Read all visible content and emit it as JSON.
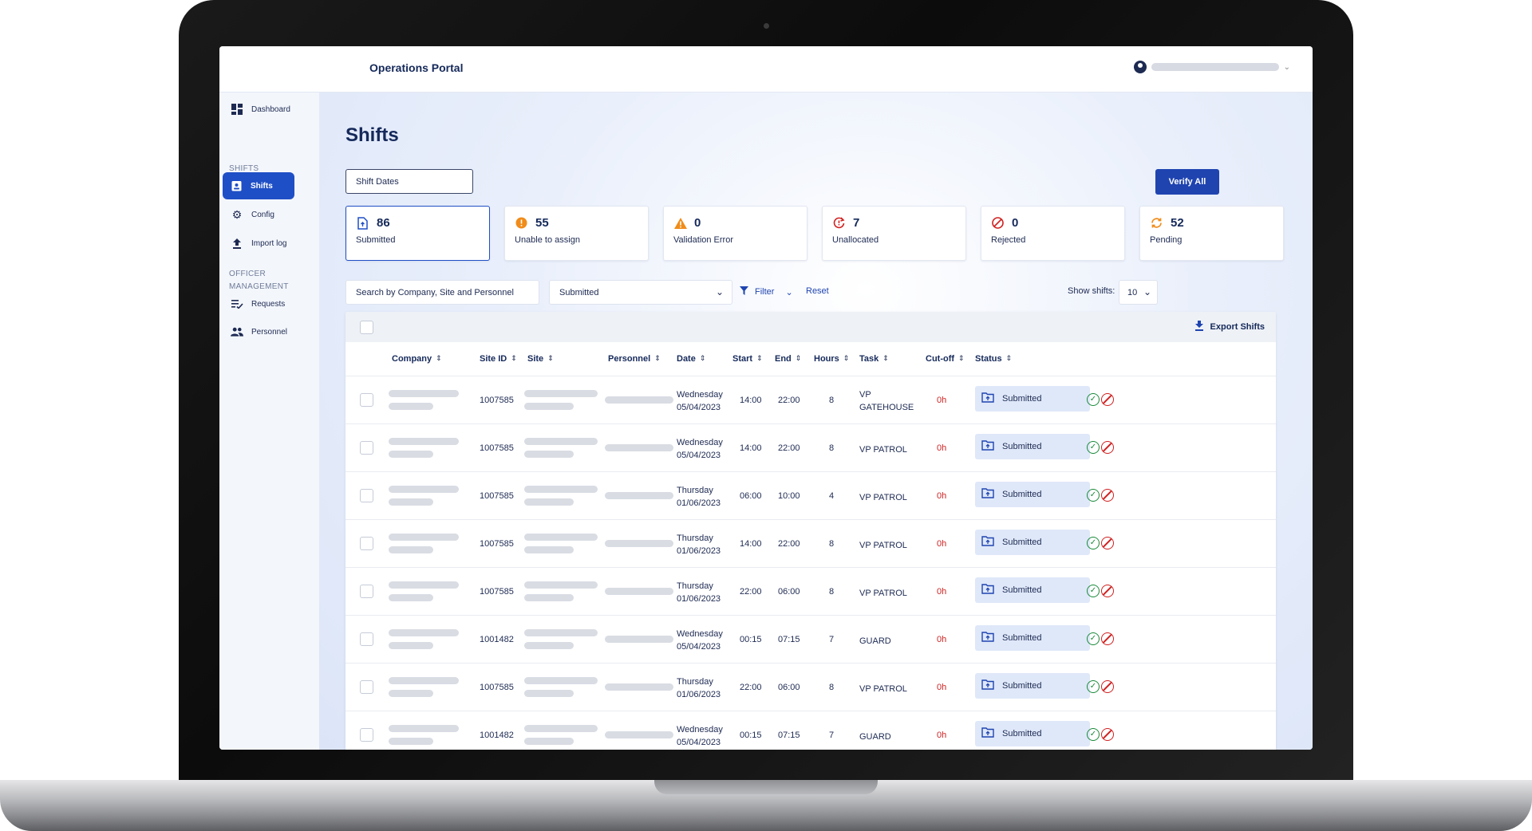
{
  "app": {
    "title": "Operations Portal"
  },
  "sidebar": {
    "items": [
      {
        "label": "Dashboard",
        "icon": "dashboard-icon"
      },
      {
        "label": "Shifts",
        "icon": "badge-icon",
        "active": true
      },
      {
        "label": "Config",
        "icon": "gear-icon"
      },
      {
        "label": "Import log",
        "icon": "upload-icon"
      },
      {
        "label": "Requests",
        "icon": "checklist-icon"
      },
      {
        "label": "Personnel",
        "icon": "people-icon"
      }
    ],
    "sections": {
      "shifts": "SHIFTS",
      "officer_line1": "OFFICER",
      "officer_line2": "MANAGEMENT"
    }
  },
  "page": {
    "title": "Shifts",
    "shift_dates": "Shift Dates",
    "verify_all": "Verify All"
  },
  "cards": [
    {
      "count": "86",
      "label": "Submitted",
      "icon": "file-upload-icon",
      "color": "#1f4fc6"
    },
    {
      "count": "55",
      "label": "Unable to assign",
      "icon": "alert-circle-icon",
      "color": "#f08c1a"
    },
    {
      "count": "0",
      "label": "Validation Error",
      "icon": "warning-triangle-icon",
      "color": "#f08c1a"
    },
    {
      "count": "7",
      "label": "Unallocated",
      "icon": "refresh-alert-icon",
      "color": "#d02020"
    },
    {
      "count": "0",
      "label": "Rejected",
      "icon": "block-icon",
      "color": "#d02020"
    },
    {
      "count": "52",
      "label": "Pending",
      "icon": "sync-icon",
      "color": "#f08c1a"
    }
  ],
  "filters": {
    "search_placeholder": "Search by Company, Site and Personnel",
    "status_value": "Submitted",
    "filter_label": "Filter",
    "reset_label": "Reset",
    "show_label": "Show shifts:",
    "show_value": "10"
  },
  "table": {
    "export_label": "Export Shifts",
    "headers": {
      "company": "Company",
      "site_id": "Site ID",
      "site": "Site",
      "personnel": "Personnel",
      "date": "Date",
      "start": "Start",
      "end": "End",
      "hours": "Hours",
      "task": "Task",
      "cutoff": "Cut-off",
      "status": "Status"
    },
    "rows": [
      {
        "site_id": "1007585",
        "day": "Wednesday",
        "date": "05/04/2023",
        "start": "14:00",
        "end": "22:00",
        "hours": "8",
        "task1": "VP",
        "task2": "GATEHOUSE",
        "cutoff": "0h",
        "status": "Submitted"
      },
      {
        "site_id": "1007585",
        "day": "Wednesday",
        "date": "05/04/2023",
        "start": "14:00",
        "end": "22:00",
        "hours": "8",
        "task1": "VP PATROL",
        "task2": "",
        "cutoff": "0h",
        "status": "Submitted"
      },
      {
        "site_id": "1007585",
        "day": "Thursday",
        "date": "01/06/2023",
        "start": "06:00",
        "end": "10:00",
        "hours": "4",
        "task1": "VP PATROL",
        "task2": "",
        "cutoff": "0h",
        "status": "Submitted"
      },
      {
        "site_id": "1007585",
        "day": "Thursday",
        "date": "01/06/2023",
        "start": "14:00",
        "end": "22:00",
        "hours": "8",
        "task1": "VP PATROL",
        "task2": "",
        "cutoff": "0h",
        "status": "Submitted"
      },
      {
        "site_id": "1007585",
        "day": "Thursday",
        "date": "01/06/2023",
        "start": "22:00",
        "end": "06:00",
        "hours": "8",
        "task1": "VP PATROL",
        "task2": "",
        "cutoff": "0h",
        "status": "Submitted"
      },
      {
        "site_id": "1001482",
        "day": "Wednesday",
        "date": "05/04/2023",
        "start": "00:15",
        "end": "07:15",
        "hours": "7",
        "task1": "GUARD",
        "task2": "",
        "cutoff": "0h",
        "status": "Submitted"
      },
      {
        "site_id": "1007585",
        "day": "Thursday",
        "date": "01/06/2023",
        "start": "22:00",
        "end": "06:00",
        "hours": "8",
        "task1": "VP PATROL",
        "task2": "",
        "cutoff": "0h",
        "status": "Submitted"
      },
      {
        "site_id": "1001482",
        "day": "Wednesday",
        "date": "05/04/2023",
        "start": "00:15",
        "end": "07:15",
        "hours": "7",
        "task1": "GUARD",
        "task2": "",
        "cutoff": "0h",
        "status": "Submitted"
      }
    ]
  }
}
